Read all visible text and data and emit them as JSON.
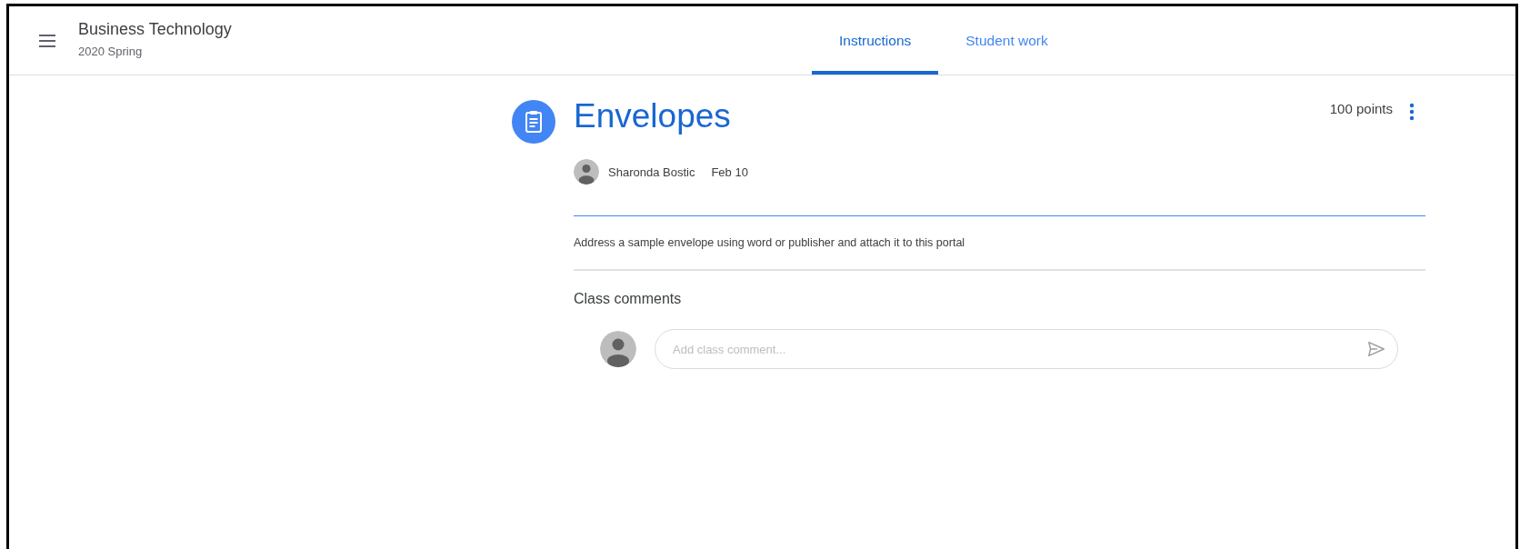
{
  "header": {
    "course_title": "Business Technology",
    "course_subtitle": "2020 Spring"
  },
  "tabs": [
    {
      "label": "Instructions",
      "selected": true
    },
    {
      "label": "Student work",
      "selected": false
    }
  ],
  "assignment": {
    "title": "Envelopes",
    "points": "100 points",
    "author": "Sharonda Bostic",
    "date": "Feb 10",
    "description": "Address a sample envelope using word or publisher and attach it to this portal"
  },
  "comments": {
    "heading": "Class comments",
    "placeholder": "Add class comment..."
  }
}
